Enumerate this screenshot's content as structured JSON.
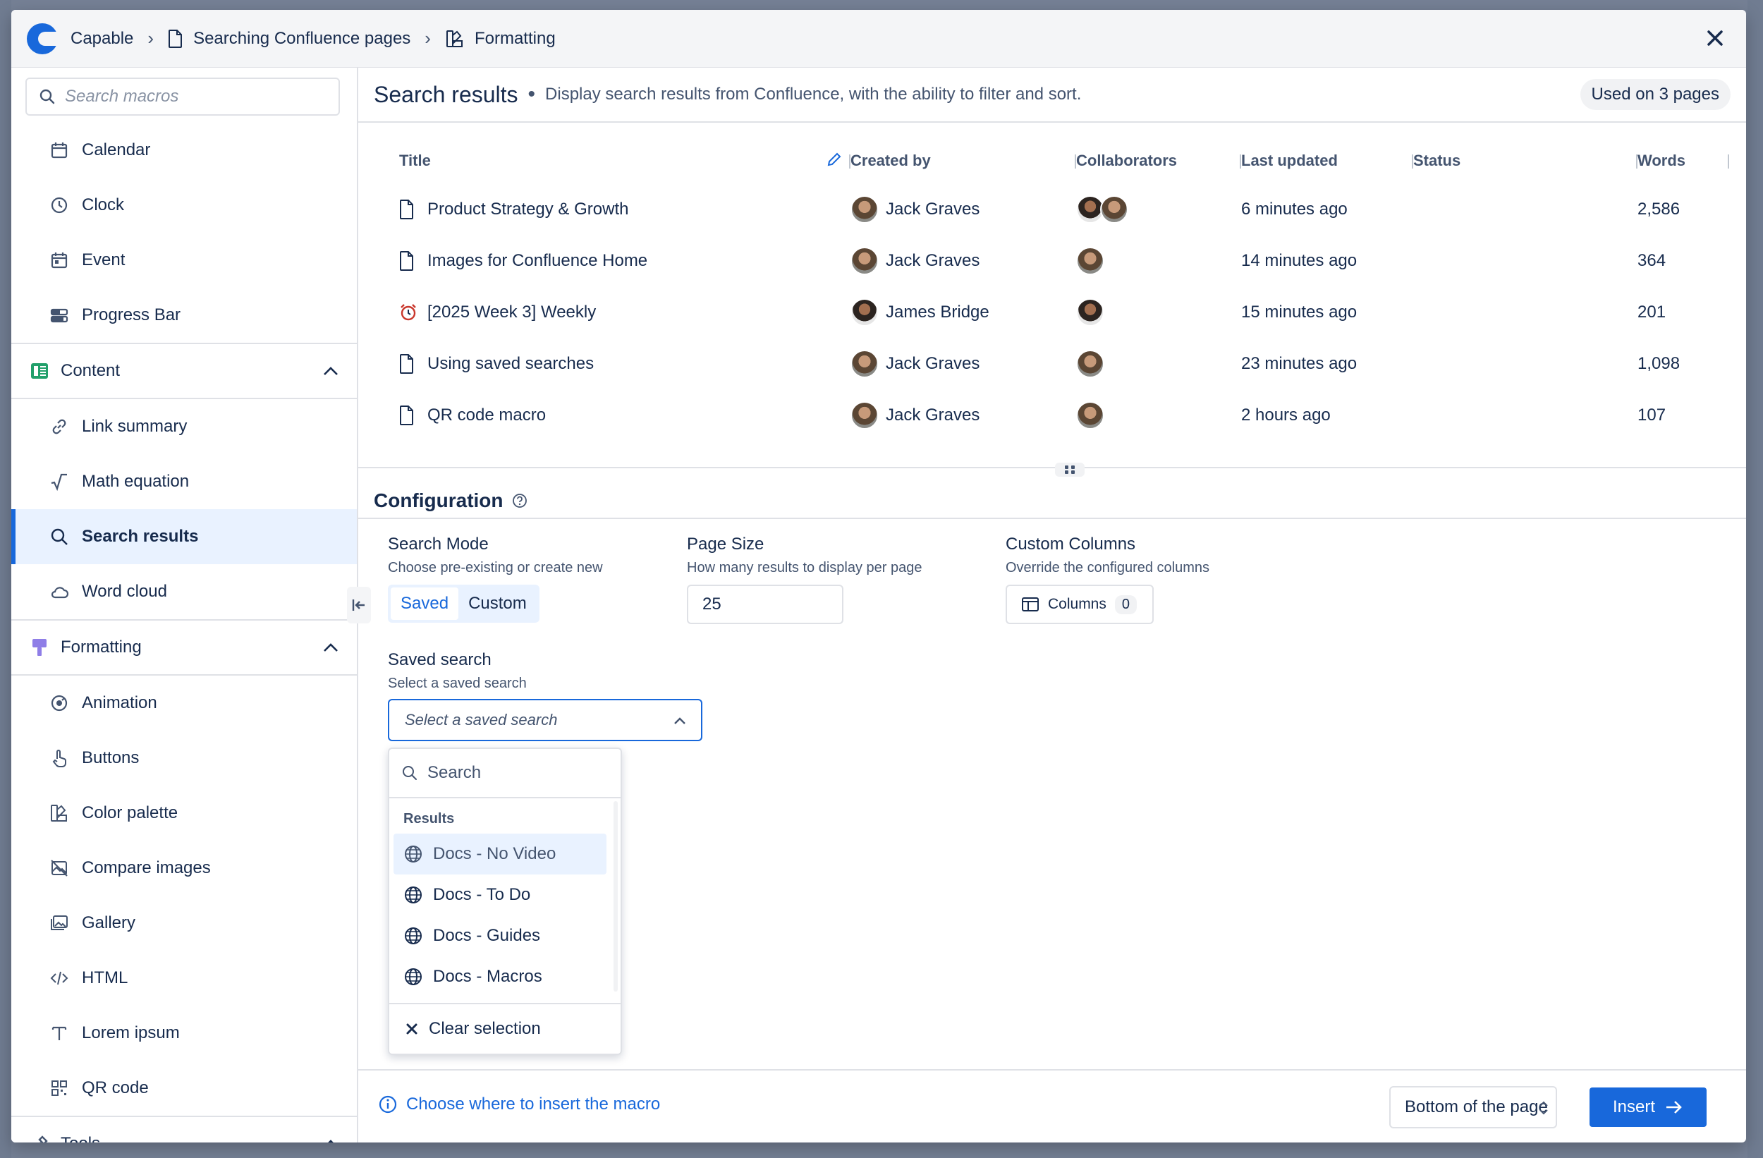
{
  "header": {
    "app_name": "Capable",
    "crumbs": [
      "Searching Confluence pages",
      "Formatting"
    ]
  },
  "sidebar": {
    "search_placeholder": "Search macros",
    "top_items": [
      {
        "label": "Calendar",
        "icon": "calendar-icon"
      },
      {
        "label": "Clock",
        "icon": "clock-icon"
      },
      {
        "label": "Event",
        "icon": "event-icon"
      },
      {
        "label": "Progress Bar",
        "icon": "progress-bar-icon"
      }
    ],
    "content_section": {
      "label": "Content",
      "icon": "content-icon"
    },
    "content_items": [
      {
        "label": "Link summary",
        "icon": "link-icon"
      },
      {
        "label": "Math equation",
        "icon": "sqrt-icon"
      },
      {
        "label": "Search results",
        "icon": "search-icon",
        "active": true
      },
      {
        "label": "Word cloud",
        "icon": "cloud-icon"
      }
    ],
    "formatting_section": {
      "label": "Formatting",
      "icon": "paint-roller-icon"
    },
    "formatting_items": [
      {
        "label": "Animation",
        "icon": "animation-icon"
      },
      {
        "label": "Buttons",
        "icon": "hand-pointer-icon"
      },
      {
        "label": "Color palette",
        "icon": "color-palette-icon"
      },
      {
        "label": "Compare images",
        "icon": "compare-images-icon"
      },
      {
        "label": "Gallery",
        "icon": "gallery-icon"
      },
      {
        "label": "HTML",
        "icon": "code-icon"
      },
      {
        "label": "Lorem ipsum",
        "icon": "text-icon"
      },
      {
        "label": "QR code",
        "icon": "qr-code-icon"
      }
    ],
    "tools_section": {
      "label": "Tools",
      "icon": "tools-icon"
    }
  },
  "main": {
    "title": "Search results",
    "description": "Display search results from Confluence, with the ability to filter and sort.",
    "used_badge": "Used on 3 pages"
  },
  "table": {
    "columns": [
      "Title",
      "Created by",
      "Collaborators",
      "Last updated",
      "Status",
      "Words"
    ],
    "rows": [
      {
        "title": "Product Strategy & Growth",
        "icon": "page-icon",
        "author": "Jack Graves",
        "collab_count": 2,
        "updated": "6 minutes ago",
        "status": "",
        "words": "2,586"
      },
      {
        "title": "Images for Confluence Home",
        "icon": "page-icon",
        "author": "Jack Graves",
        "collab_count": 1,
        "updated": "14 minutes ago",
        "status": "",
        "words": "364"
      },
      {
        "title": "[2025 Week 3] Weekly",
        "icon": "alarm-clock-icon",
        "author": "James Bridge",
        "collab_count": 1,
        "updated": "15 minutes ago",
        "status": "",
        "words": "201"
      },
      {
        "title": "Using saved searches",
        "icon": "page-icon",
        "author": "Jack Graves",
        "collab_count": 1,
        "updated": "23 minutes ago",
        "status": "",
        "words": "1,098"
      },
      {
        "title": "QR code macro",
        "icon": "page-icon",
        "author": "Jack Graves",
        "collab_count": 1,
        "updated": "2 hours ago",
        "status": "",
        "words": "107"
      }
    ]
  },
  "config": {
    "title": "Configuration",
    "search_mode": {
      "label": "Search Mode",
      "help": "Choose pre-existing or create new",
      "options": [
        "Saved",
        "Custom"
      ],
      "selected": "Saved"
    },
    "page_size": {
      "label": "Page Size",
      "help": "How many results to display per page",
      "value": "25"
    },
    "custom_columns": {
      "label": "Custom Columns",
      "help": "Override the configured columns",
      "button": "Columns",
      "count": "0"
    },
    "saved_search": {
      "label": "Saved search",
      "help": "Select a saved search",
      "placeholder": "Select a saved search"
    }
  },
  "dropdown": {
    "search_placeholder": "Search",
    "group_label": "Results",
    "items": [
      "Docs - No Video",
      "Docs - To Do",
      "Docs - Guides",
      "Docs - Macros"
    ],
    "highlighted": "Docs - No Video",
    "clear_label": "Clear selection"
  },
  "footer": {
    "hint": "Choose where to insert the macro",
    "position": "Bottom of the page",
    "insert_label": "Insert"
  },
  "colors": {
    "accent": "#1868db",
    "highlight": "#e9f2ff",
    "border": "#dfe1e6",
    "content_green": "#22a06b",
    "formatting_purple": "#8f7ee7"
  }
}
